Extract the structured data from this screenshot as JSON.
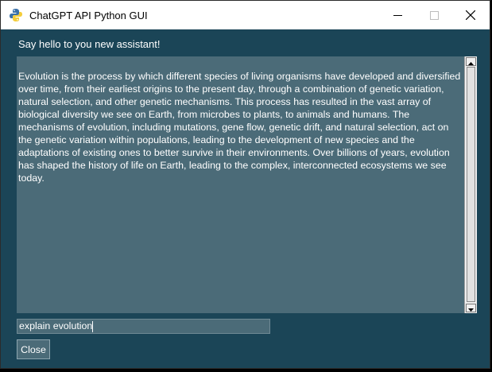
{
  "window": {
    "title": "ChatGPT API Python GUI",
    "controls": {
      "minimize": "minimize-icon",
      "maximize": "maximize-icon",
      "close": "close-icon"
    }
  },
  "main": {
    "greeting": "Say hello to you new assistant!",
    "response": "Evolution is the process by which different species of living organisms have developed and diversified over time, from their earliest origins to the present day, through a combination of genetic variation, natural selection, and other genetic mechanisms. This process has resulted in the vast array of biological diversity we see on Earth, from microbes to plants, to animals and humans. The mechanisms of evolution, including mutations, gene flow, genetic drift, and natural selection, act on the genetic variation within populations, leading to the development of new species and the adaptations of existing ones to better survive in their environments. Over billions of years, evolution has shaped the history of life on Earth, leading to the complex, interconnected ecosystems we see today.",
    "input_value": "explain evolution",
    "close_label": "Close"
  },
  "colors": {
    "window_bg": "#1b4557",
    "panel_bg": "#4b6b78",
    "text": "#ffffff"
  }
}
